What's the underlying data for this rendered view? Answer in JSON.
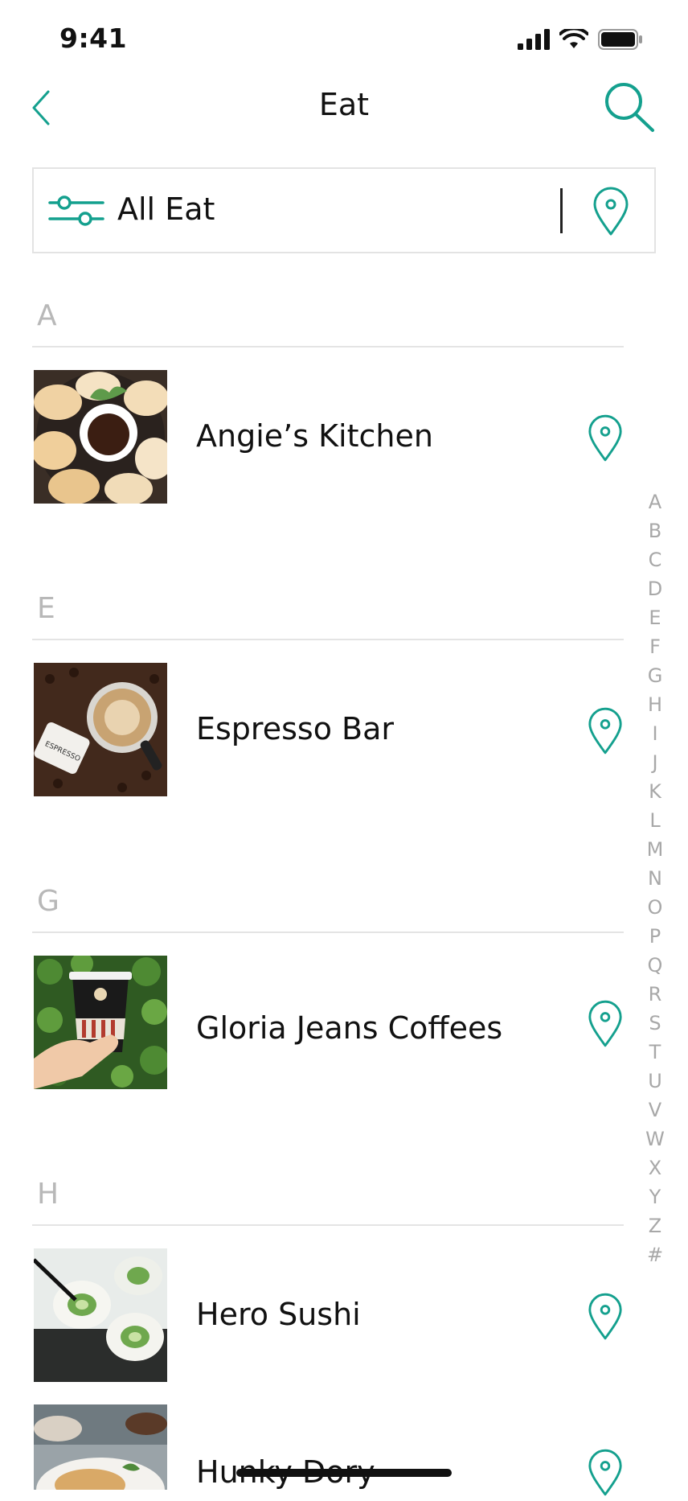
{
  "status_bar": {
    "time": "9:41"
  },
  "nav": {
    "title": "Eat"
  },
  "filter": {
    "label": "All Eat"
  },
  "colors": {
    "accent": "#14a08e",
    "section_letter": "#b8b8b8",
    "index_letter": "#a8a8a8"
  },
  "sections": [
    {
      "letter": "A",
      "items": [
        {
          "name": "Angie’s Kitchen",
          "thumb": "dumplings"
        }
      ]
    },
    {
      "letter": "E",
      "items": [
        {
          "name": "Espresso Bar",
          "thumb": "coffee"
        }
      ]
    },
    {
      "letter": "G",
      "items": [
        {
          "name": "Gloria Jeans Coffees",
          "thumb": "cup"
        }
      ]
    },
    {
      "letter": "H",
      "items": [
        {
          "name": "Hero Sushi",
          "thumb": "sushi"
        },
        {
          "name": "Hunky Dory",
          "thumb": "plate"
        }
      ]
    }
  ],
  "index_letters": [
    "A",
    "B",
    "C",
    "D",
    "E",
    "F",
    "G",
    "H",
    "I",
    "J",
    "K",
    "L",
    "M",
    "N",
    "O",
    "P",
    "Q",
    "R",
    "S",
    "T",
    "U",
    "V",
    "W",
    "X",
    "Y",
    "Z",
    "#"
  ]
}
